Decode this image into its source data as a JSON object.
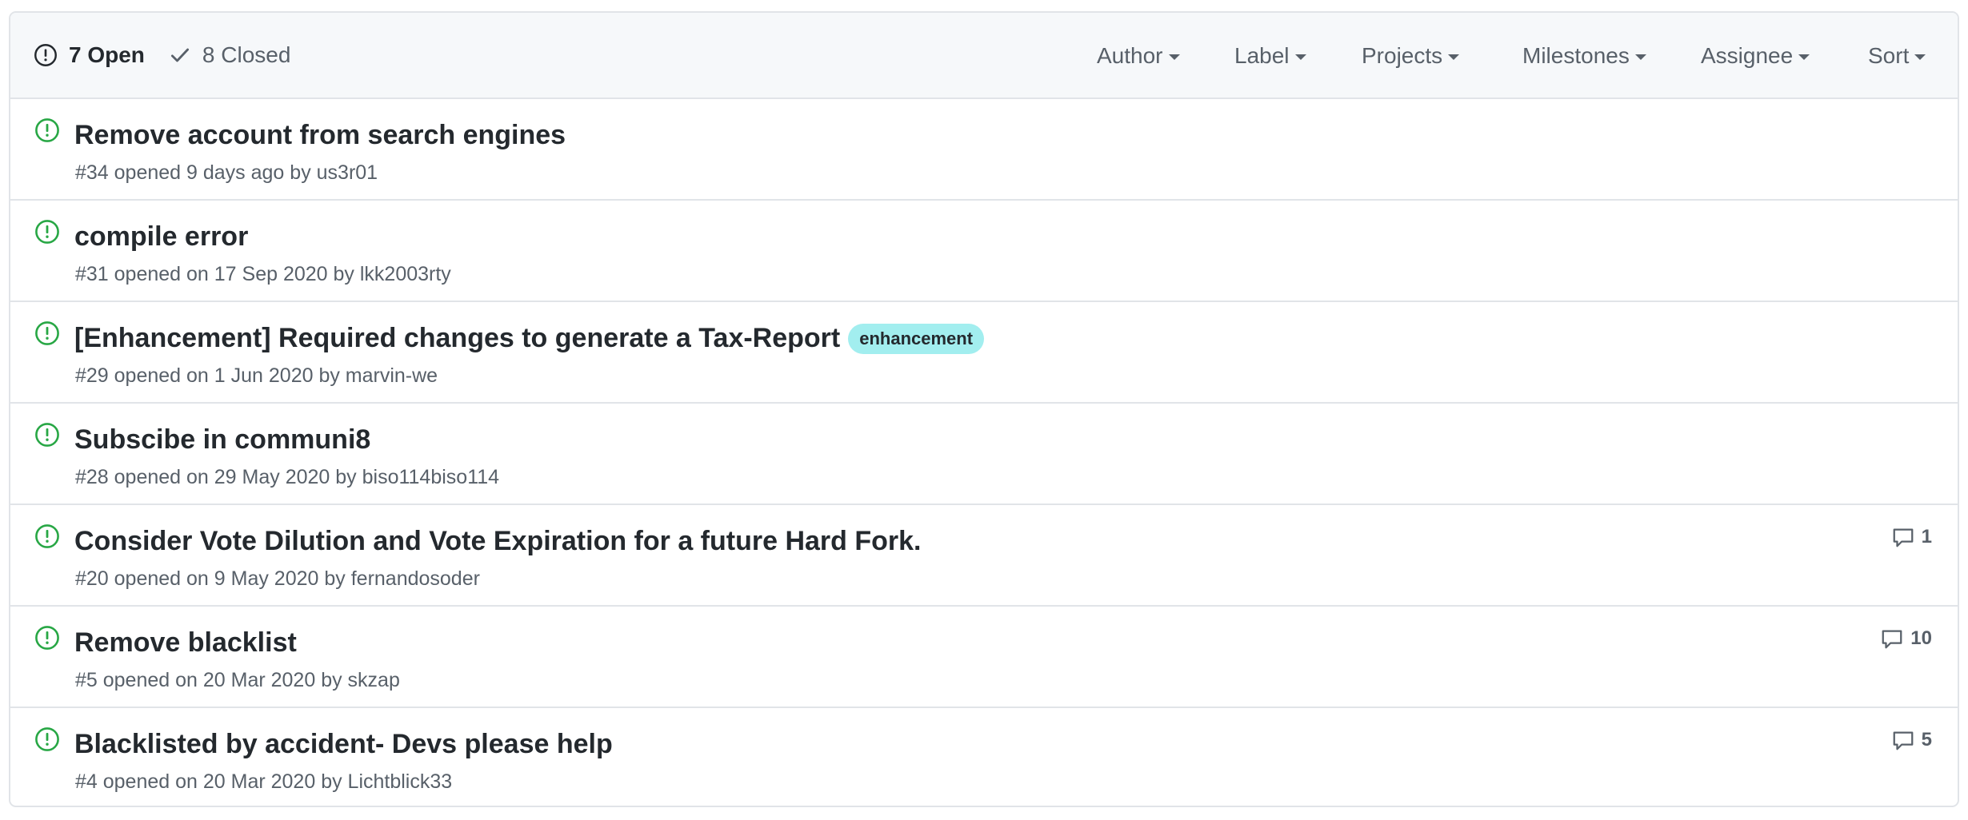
{
  "header": {
    "open_count": "7 Open",
    "closed_count": "8 Closed",
    "filters": [
      "Author",
      "Label",
      "Projects",
      "Milestones",
      "Assignee",
      "Sort"
    ]
  },
  "issues": [
    {
      "title": "Remove account from search engines",
      "meta": "#34 opened 9 days ago by us3r01",
      "label": "",
      "comments": ""
    },
    {
      "title": "compile error",
      "meta": "#31 opened on 17 Sep 2020 by lkk2003rty",
      "label": "",
      "comments": ""
    },
    {
      "title": "[Enhancement] Required changes to generate a Tax-Report",
      "meta": "#29 opened on 1 Jun 2020 by marvin-we",
      "label": "enhancement",
      "comments": ""
    },
    {
      "title": "Subscibe in communi8",
      "meta": "#28 opened on 29 May 2020 by biso114biso114",
      "label": "",
      "comments": ""
    },
    {
      "title": "Consider Vote Dilution and Vote Expiration for a future Hard Fork.",
      "meta": "#20 opened on 9 May 2020 by fernandosoder",
      "label": "",
      "comments": "1"
    },
    {
      "title": "Remove blacklist",
      "meta": "#5 opened on 20 Mar 2020 by skzap",
      "label": "",
      "comments": "10"
    },
    {
      "title": "Blacklisted by accident- Devs please help",
      "meta": "#4 opened on 20 Mar 2020 by Lichtblick33",
      "label": "",
      "comments": "5"
    }
  ],
  "colors": {
    "open_icon": "#28a745",
    "label_enhancement": "#a2eeef",
    "header_bg": "#f6f8fa",
    "border": "#e1e4e8"
  },
  "icons": {
    "open_state": "issue-opened-icon",
    "closed_state": "check-icon",
    "issue": "issue-opened-icon",
    "comment": "comment-icon",
    "dropdown": "caret-down-icon"
  }
}
